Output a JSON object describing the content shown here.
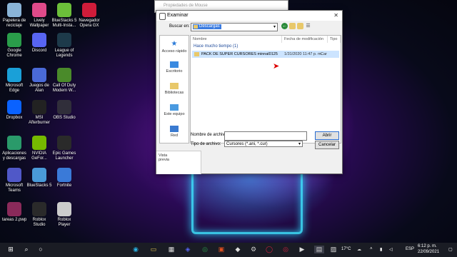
{
  "desktop": {
    "icons": [
      {
        "label": "Papelera de reciclaje",
        "icon": "recycle-bin-icon",
        "color": "#8ab4d8"
      },
      {
        "label": "Lively Wallpaper",
        "icon": "lively-icon",
        "color": "#e04a8a"
      },
      {
        "label": "BlueStacks 5 Multi-Insta...",
        "icon": "bluestacks-icon",
        "color": "#6cbf3a"
      },
      {
        "label": "Navegador Opera GX",
        "icon": "opera-gx-icon",
        "color": "#d01c3a"
      },
      {
        "label": "Google Chrome",
        "icon": "chrome-icon",
        "color": "#2a9d4a"
      },
      {
        "label": "Discord",
        "icon": "discord-icon",
        "color": "#5865f2"
      },
      {
        "label": "League of Legends",
        "icon": "lol-icon",
        "color": "#1d3a4a"
      },
      {
        "label": "Microsoft Edge",
        "icon": "edge-icon",
        "color": "#1aa0d8"
      },
      {
        "label": "Juegos de Alan",
        "icon": "games-folder-icon",
        "color": "#4a6ad8"
      },
      {
        "label": "Call Of Duty Modern W...",
        "icon": "cod-icon",
        "color": "#4a8a2a"
      },
      {
        "label": "Dropbox",
        "icon": "dropbox-icon",
        "color": "#0a62ff"
      },
      {
        "label": "MSI Afterburner",
        "icon": "msi-icon",
        "color": "#222"
      },
      {
        "label": "OBS Studio",
        "icon": "obs-icon",
        "color": "#302e3a"
      },
      {
        "label": "Aplicaciones y descargas",
        "icon": "apps-folder-icon",
        "color": "#2a9a6a"
      },
      {
        "label": "NVIDIA GeFor...",
        "icon": "nvidia-icon",
        "color": "#76b900"
      },
      {
        "label": "Epic Games Launcher",
        "icon": "epic-icon",
        "color": "#2a2a2a"
      },
      {
        "label": "Microsoft Teams",
        "icon": "teams-icon",
        "color": "#5058c8"
      },
      {
        "label": "BlueStacks 5",
        "icon": "bluestacks5-icon",
        "color": "#4a9ad8"
      },
      {
        "label": "Fortnite",
        "icon": "fortnite-icon",
        "color": "#3a7ad8"
      },
      {
        "label": "tareas 2.pwp",
        "icon": "document-icon",
        "color": "#8a2a5a"
      },
      {
        "label": "Roblox Studio",
        "icon": "roblox-studio-icon",
        "color": "#2a2a2a"
      },
      {
        "label": "Roblox Player",
        "icon": "roblox-icon",
        "color": "#cccccc"
      }
    ]
  },
  "outer_window": {
    "title": "Propiedades de Mouse"
  },
  "dialog": {
    "title": "Examinar",
    "look_in_label": "Buscar en:",
    "look_in_value": "Descargas",
    "places": [
      "Acceso rápido",
      "Escritorio",
      "Bibliotecas",
      "Este equipo",
      "Red"
    ],
    "columns": [
      "Nombre",
      "Fecha de modificación",
      "Tipo"
    ],
    "group": "Hace mucho tiempo (1)",
    "files": [
      {
        "name": "PACK DE SUPER CURSORES minnal0125",
        "date": "1/31/2020 11:47 p. m.",
        "type": "Car"
      }
    ],
    "filename_label": "Nombre de archivo:",
    "filename_value": "",
    "filetype_label": "Tipo de archivo:",
    "filetype_value": "Cursores (*.ani, *.cur)",
    "open_button": "Abrir",
    "cancel_button": "Cancelar",
    "preview_label": "Vista previa"
  },
  "taskbar": {
    "temperature": "17°C",
    "language": "ESP",
    "time": "6:12 p. m.",
    "date": "22/09/2021"
  }
}
